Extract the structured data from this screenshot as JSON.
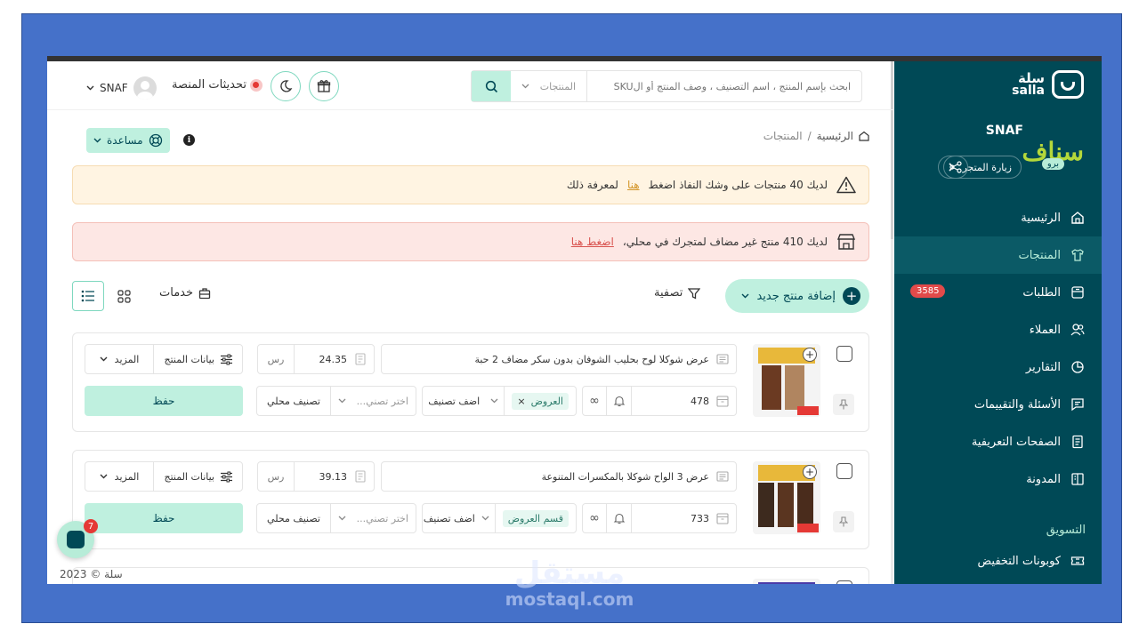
{
  "app": {
    "brand_ar": "سلة",
    "brand_en": "salla"
  },
  "store": {
    "name": "SNAF",
    "logo_text": "سناف",
    "plan": "برو",
    "visit_label": "زيارة المتجر"
  },
  "sidebar": {
    "items": [
      {
        "label": "الرئيسية",
        "icon": "home-icon"
      },
      {
        "label": "المنتجات",
        "icon": "shirt-icon",
        "active": true
      },
      {
        "label": "الطلبات",
        "icon": "orders-icon",
        "badge": "3585"
      },
      {
        "label": "العملاء",
        "icon": "users-icon"
      },
      {
        "label": "التقارير",
        "icon": "pie-chart-icon"
      },
      {
        "label": "الأسئلة والتقييمات",
        "icon": "comment-icon"
      },
      {
        "label": "الصفحات التعريفية",
        "icon": "document-icon"
      },
      {
        "label": "المدونة",
        "icon": "blog-icon"
      }
    ],
    "section": "التسويق",
    "section_items": [
      {
        "label": "كوبونات التخفيض",
        "icon": "ticket-icon"
      }
    ]
  },
  "header": {
    "search_placeholder": "ابحث بإسم المنتج ، اسم التصنيف ، وصف المنتج أو الSKU",
    "search_scope": "المنتجات",
    "updates_label": "تحديثات المنصة",
    "user_name": "SNAF"
  },
  "breadcrumb": {
    "home": "الرئيسية",
    "sep": "/",
    "current": "المنتجات"
  },
  "help_label": "مساعدة",
  "alerts": {
    "warn": {
      "text": "لديك 40 منتجات على وشك النفاذ اضغط",
      "link": "هنا",
      "suffix": "لمعرفة ذلك"
    },
    "danger": {
      "text": "لديك 410 منتج غير مضاف لمتجرك في محلي،",
      "link": "اضغط هنا"
    }
  },
  "toolbar": {
    "add_product": "إضافة منتج جديد",
    "filter": "تصفية",
    "services": "خدمات"
  },
  "products": [
    {
      "name": "عرض شوكلا لوح بحليب الشوفان بدون سكر مضاف 2 حبة",
      "price": "24.35",
      "currency": "رس",
      "product_data": "بيانات المنتج",
      "more": "المزيد",
      "quantity": "478",
      "category_chip": "العروض",
      "add_category": "اضف تصنيف",
      "local_pick": "اختر تصني...",
      "local_category": "تصنيف محلي",
      "save": "حفظ"
    },
    {
      "name": "عرض 3 الواح شوكلا بالمكسرات المتنوعة",
      "price": "39.13",
      "currency": "رس",
      "product_data": "بيانات المنتج",
      "more": "المزيد",
      "quantity": "733",
      "category_chip": "قسم العروض",
      "add_category": "اضف تصنيف",
      "local_pick": "اختر تصني...",
      "local_category": "تصنيف محلي",
      "save": "حفظ"
    }
  ],
  "chat": {
    "count": "7"
  },
  "footer": {
    "copyright": "سلة © 2023"
  },
  "watermark": {
    "ar": "مستقل",
    "en": "mostaql.com"
  },
  "colors": {
    "primary": "#004956",
    "accent": "#bff0df",
    "frame": "#4571c9",
    "danger": "#e24a4a"
  }
}
